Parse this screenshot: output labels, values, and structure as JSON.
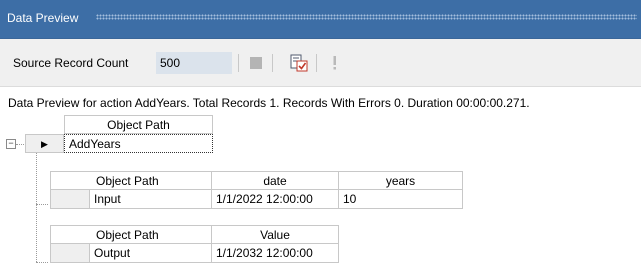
{
  "panel": {
    "title": "Data Preview"
  },
  "toolbar": {
    "source_count_label": "Source Record Count",
    "source_count_value": "500",
    "icons": [
      "stop-icon",
      "preview-check-icon",
      "exclamation-icon"
    ]
  },
  "status": {
    "text": "Data Preview for action AddYears. Total Records 1. Records With Errors 0. Duration 00:00:00.271."
  },
  "grid": {
    "top_header": "Object Path",
    "root_row": {
      "expander": "−",
      "pointer": "▶",
      "path": "AddYears"
    },
    "input_table": {
      "headers": [
        "Object Path",
        "date",
        "years"
      ],
      "row": [
        "Input",
        "1/1/2022 12:00:00",
        "10"
      ]
    },
    "output_table": {
      "headers": [
        "Object Path",
        "Value"
      ],
      "row": [
        "Output",
        "1/1/2032 12:00:00"
      ]
    }
  }
}
